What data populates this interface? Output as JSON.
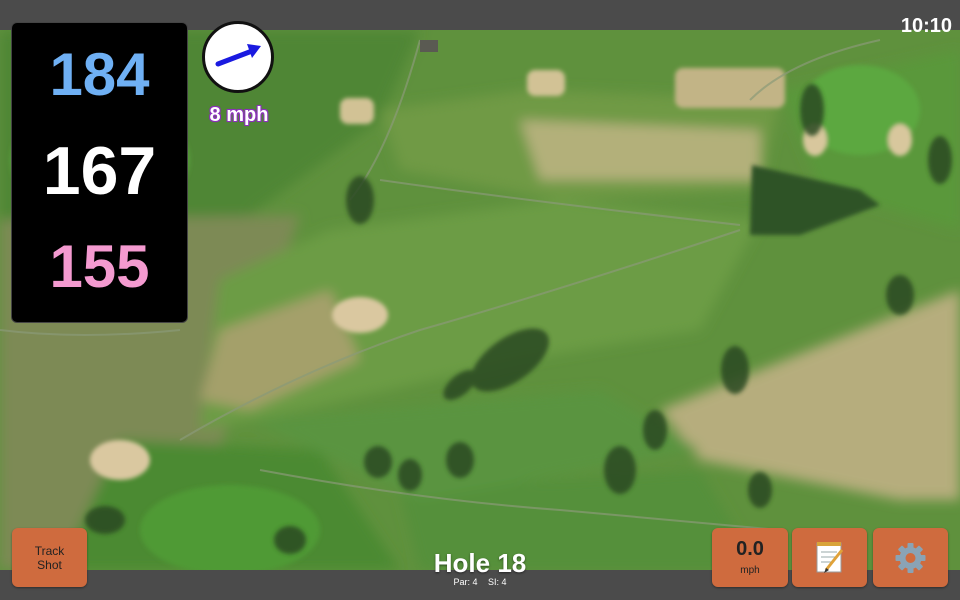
{
  "status": {
    "time": "10:10"
  },
  "yardages": {
    "back": "184",
    "center": "167",
    "front": "155"
  },
  "wind": {
    "speed_label": "8 mph",
    "arrow_icon": "arrow-right-up-icon",
    "arrow_color": "#1a1ae0"
  },
  "hole": {
    "title": "Hole 18",
    "par_label": "Par: 4",
    "si_label": "SI: 4"
  },
  "buttons": {
    "track_shot": {
      "line1": "Track",
      "line2": "Shot"
    },
    "speed": {
      "value": "0.0",
      "unit": "mph"
    },
    "notes_icon": "notepad-icon",
    "settings_icon": "gear-icon"
  },
  "colors": {
    "button": "#cf6b3e",
    "back": "#6fb0f4",
    "center": "#ffffff",
    "front": "#f49ad0",
    "wind_text_outline": "#8d2fbe"
  }
}
